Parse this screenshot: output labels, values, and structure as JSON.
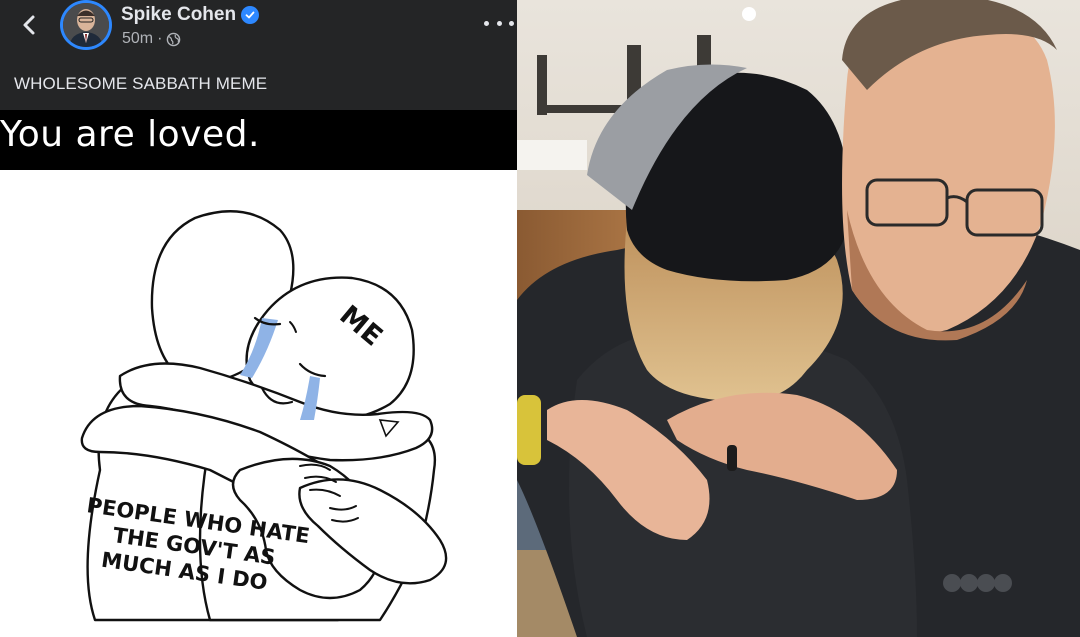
{
  "post": {
    "author": "Spike Cohen",
    "time": "50m",
    "separator": "·",
    "caption": "WHOLESOME SABBATH MEME",
    "icons": {
      "back": "chevron-left-icon",
      "verified": "verified-badge-icon",
      "audience": "globe-icon",
      "more": "more-options-icon"
    }
  },
  "meme": {
    "banner": "You are loved.",
    "label_me": "ME",
    "label_people": [
      "PEOPLE WHO HATE",
      "THE GOV'T AS",
      "MUCH AS I DO"
    ]
  },
  "colors": {
    "header_bg": "#242526",
    "text_primary": "#e4e6eb",
    "text_secondary": "#b0b3b8",
    "accent": "#2d88ff",
    "tears": "#8fb3e6"
  }
}
